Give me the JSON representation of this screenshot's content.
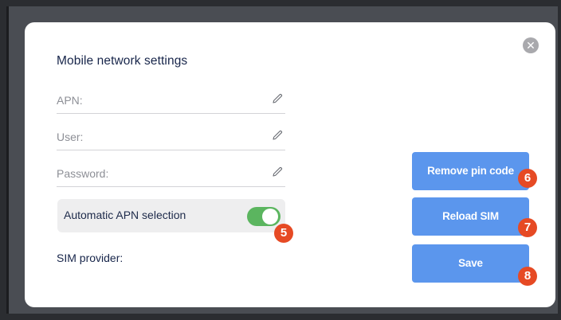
{
  "dialog": {
    "title": "Mobile network settings",
    "close_icon": "close-icon"
  },
  "fields": [
    {
      "label": "APN:",
      "icon": "pencil-icon"
    },
    {
      "label": "User:",
      "icon": "pencil-icon"
    },
    {
      "label": "Password:",
      "icon": "pencil-icon"
    }
  ],
  "toggle": {
    "label": "Automatic APN selection",
    "state": "on",
    "color": "#5bb55f"
  },
  "sim_provider": {
    "label": "SIM provider:"
  },
  "buttons": {
    "remove_pin": "Remove pin code",
    "reload_sim": "Reload SIM",
    "save": "Save",
    "color": "#5b96ed"
  },
  "badges": {
    "toggle": "5",
    "remove_pin": "6",
    "reload_sim": "7",
    "save": "8",
    "color": "#e64a24"
  }
}
